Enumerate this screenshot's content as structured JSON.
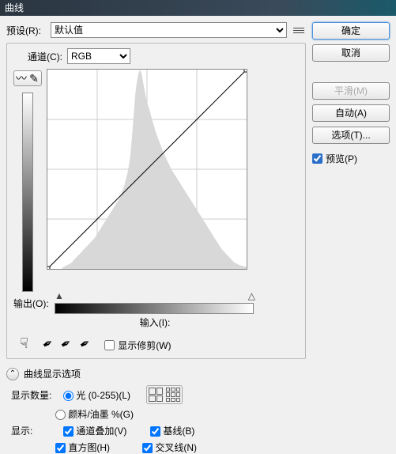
{
  "title": "曲线",
  "preset": {
    "label": "预设(R):",
    "value": "默认值"
  },
  "channel": {
    "label": "通道(C):",
    "value": "RGB"
  },
  "output_label": "输出(O):",
  "input_label": "输入(I):",
  "show_clipping": "显示修剪(W)",
  "section_title": "曲线显示选项",
  "show_amount": {
    "label": "显示数量:",
    "light": "光 (0-255)(L)",
    "pigment": "颜料/油墨 %(G)"
  },
  "show": {
    "label": "显示:",
    "channel_overlay": "通道叠加(V)",
    "baseline": "基线(B)",
    "histogram": "直方图(H)",
    "intersection": "交叉线(N)"
  },
  "buttons": {
    "ok": "确定",
    "cancel": "取消",
    "smooth": "平滑(M)",
    "auto": "自动(A)",
    "options": "选项(T)..."
  },
  "preview_label": "预览(P)",
  "chart_data": {
    "type": "line",
    "title": "",
    "xlabel": "输入",
    "ylabel": "输出",
    "xlim": [
      0,
      255
    ],
    "ylim": [
      0,
      255
    ],
    "series": [
      {
        "name": "curve",
        "x": [
          0,
          255
        ],
        "y": [
          0,
          255
        ]
      }
    ],
    "histogram": [
      0,
      0,
      0,
      0,
      0,
      0,
      0,
      0,
      0,
      0,
      2,
      3,
      4,
      5,
      6,
      7,
      9,
      11,
      13,
      15,
      17,
      19,
      21,
      23,
      25,
      27,
      29,
      31,
      33,
      35,
      37,
      40,
      43,
      46,
      49,
      52,
      55,
      58,
      61,
      64,
      67,
      70,
      73,
      76,
      79,
      82,
      85,
      90,
      95,
      100,
      108,
      115,
      125,
      140,
      160,
      185,
      210,
      225,
      235,
      240,
      235,
      225,
      215,
      205,
      198,
      192,
      185,
      178,
      172,
      165,
      160,
      155,
      150,
      145,
      140,
      136,
      132,
      128,
      124,
      120,
      117,
      114,
      111,
      108,
      105,
      102,
      99,
      96,
      93,
      90,
      87,
      84,
      81,
      78,
      75,
      72,
      69,
      66,
      63,
      60,
      57,
      54,
      51,
      48,
      45,
      42,
      39,
      36,
      33,
      30,
      27,
      24,
      22,
      20,
      18,
      16,
      14,
      12,
      10,
      8,
      7,
      6,
      5,
      4,
      4,
      3,
      3,
      2
    ]
  }
}
